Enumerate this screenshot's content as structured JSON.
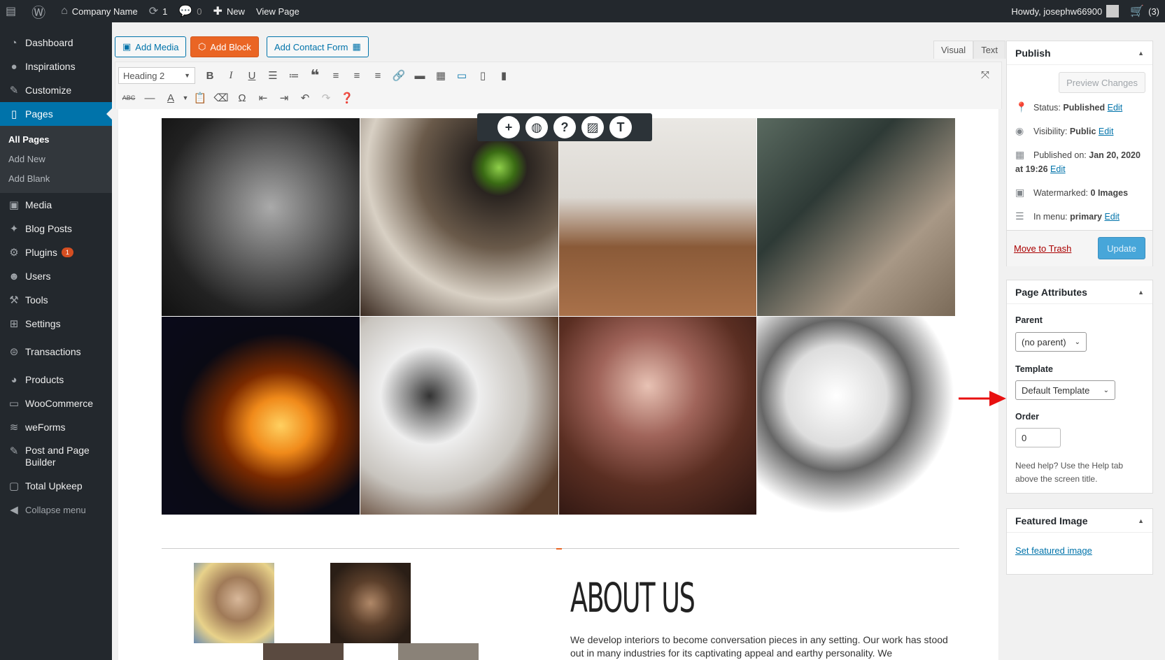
{
  "adminbar": {
    "site_name": "Company Name",
    "updates_count": "1",
    "comments_count": "0",
    "new_label": "New",
    "view_page_label": "View Page",
    "howdy": "Howdy, josephw66900",
    "cart_count": "(3)"
  },
  "sidebar": {
    "items": [
      {
        "label": "Dashboard",
        "icon": "dashboard-icon"
      },
      {
        "label": "Inspirations",
        "icon": "lightbulb-icon"
      },
      {
        "label": "Customize",
        "icon": "brush-icon"
      },
      {
        "label": "Pages",
        "icon": "pages-icon"
      },
      {
        "label": "Media",
        "icon": "media-icon"
      },
      {
        "label": "Blog Posts",
        "icon": "pin-icon"
      },
      {
        "label": "Plugins",
        "icon": "plugin-icon",
        "badge": "1"
      },
      {
        "label": "Users",
        "icon": "users-icon"
      },
      {
        "label": "Tools",
        "icon": "tools-icon"
      },
      {
        "label": "Settings",
        "icon": "settings-icon"
      },
      {
        "label": "Transactions",
        "icon": "transactions-icon"
      },
      {
        "label": "Products",
        "icon": "products-icon"
      },
      {
        "label": "WooCommerce",
        "icon": "woo-icon"
      },
      {
        "label": "weForms",
        "icon": "weforms-icon"
      },
      {
        "label": "Post and Page",
        "label2": "Builder",
        "icon": "builder-icon"
      },
      {
        "label": "Total Upkeep",
        "icon": "upkeep-icon"
      },
      {
        "label": "Collapse menu",
        "icon": "collapse-icon"
      }
    ],
    "submenu": [
      "All Pages",
      "Add New",
      "Add Blank"
    ]
  },
  "editor": {
    "add_media": "Add Media",
    "add_block": "Add Block",
    "add_contact_form": "Add Contact Form",
    "tab_visual": "Visual",
    "tab_text": "Text",
    "format_select": "Heading 2",
    "about_title": "ABOUT US",
    "about_text": "We develop interiors to become conversation pieces in any setting. Our work has stood out in many industries for its captivating appeal and earthy personality. We"
  },
  "publish": {
    "title": "Publish",
    "preview": "Preview Changes",
    "status_label": "Status:",
    "status_value": "Published",
    "visibility_label": "Visibility:",
    "visibility_value": "Public",
    "published_on_label": "Published on:",
    "published_on_value": "Jan 20, 2020",
    "published_at": "at 19:26",
    "watermarked_label": "Watermarked:",
    "watermarked_value": "0 Images",
    "menu_label": "In menu:",
    "menu_value": "primary",
    "edit": "Edit",
    "trash": "Move to Trash",
    "update": "Update"
  },
  "page_attributes": {
    "title": "Page Attributes",
    "parent_label": "Parent",
    "parent_value": "(no parent)",
    "template_label": "Template",
    "template_value": "Default Template",
    "order_label": "Order",
    "order_value": "0",
    "help_line1": "Need help? Use the Help tab",
    "help_line2": "above the screen title."
  },
  "featured": {
    "title": "Featured Image",
    "link": "Set featured image"
  }
}
